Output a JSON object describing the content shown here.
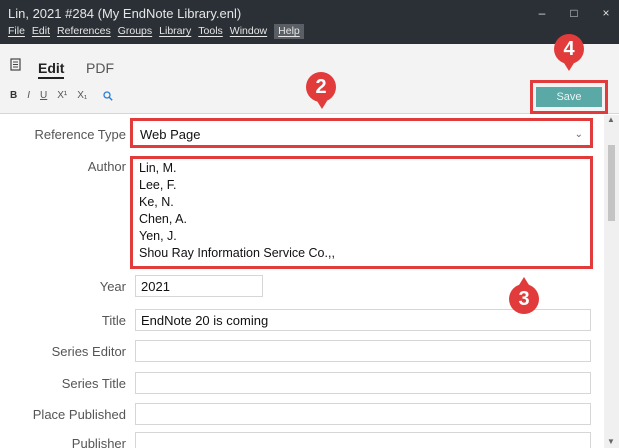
{
  "window": {
    "title": "Lin, 2021 #284 (My EndNote Library.enl)",
    "controls": {
      "minimize": "–",
      "maximize": "□",
      "close": "×"
    }
  },
  "menu": [
    "File",
    "Edit",
    "References",
    "Groups",
    "Library",
    "Tools",
    "Window",
    "Help"
  ],
  "toolbar": {
    "tabs": {
      "edit": "Edit",
      "pdf": "PDF"
    },
    "format": {
      "bold": "B",
      "italic": "I",
      "underline": "U",
      "superscript": "X¹",
      "subscript": "X₁"
    },
    "save_label": "Save"
  },
  "form": {
    "reference_type": {
      "label": "Reference Type",
      "value": "Web Page"
    },
    "author": {
      "label": "Author",
      "lines": [
        "Lin, M.",
        "Lee, F.",
        "Ke, N.",
        "Chen, A.",
        "Yen, J.",
        "Shou Ray Information Service Co.,,"
      ]
    },
    "year": {
      "label": "Year",
      "value": "2021"
    },
    "title": {
      "label": "Title",
      "value": "EndNote 20 is coming"
    },
    "series_editor": {
      "label": "Series Editor",
      "value": ""
    },
    "series_title": {
      "label": "Series Title",
      "value": ""
    },
    "place_published": {
      "label": "Place Published",
      "value": ""
    },
    "publisher": {
      "label": "Publisher",
      "value": ""
    }
  },
  "annotations": {
    "badge2": "2",
    "badge3": "3",
    "badge4": "4"
  },
  "colors": {
    "titlebar": "#2b3036",
    "accent_save": "#5aa9a6",
    "annotation_red": "#e23b3b"
  }
}
